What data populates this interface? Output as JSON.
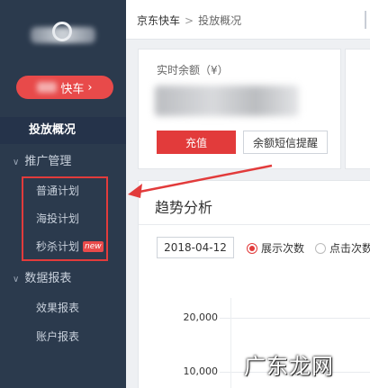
{
  "sidebar": {
    "shop_button_label": "快车",
    "nav_overview": "投放概况",
    "group_promo": "推广管理",
    "promo_items": [
      "普通计划",
      "海投计划",
      "秒杀计划"
    ],
    "badge_new": "new",
    "group_reports": "数据报表",
    "report_items": [
      "效果报表",
      "账户报表"
    ]
  },
  "topbar": {
    "breadcrumb_root": "京东快车",
    "breadcrumb_sep": ">",
    "breadcrumb_current": "投放概况"
  },
  "balance": {
    "label": "实时余额（¥）",
    "recharge_label": "充值",
    "remind_label": "余额短信提醒"
  },
  "trend": {
    "title": "趋势分析",
    "date": "2018-04-12",
    "radio_show": "展示次数",
    "radio_click": "点击次数",
    "y_ticks": [
      "20,000",
      "10,000"
    ]
  },
  "watermark": {
    "text": "广东龙网"
  },
  "colors": {
    "sidebar_bg": "#2b3a4d",
    "accent_red": "#e23b3b"
  }
}
